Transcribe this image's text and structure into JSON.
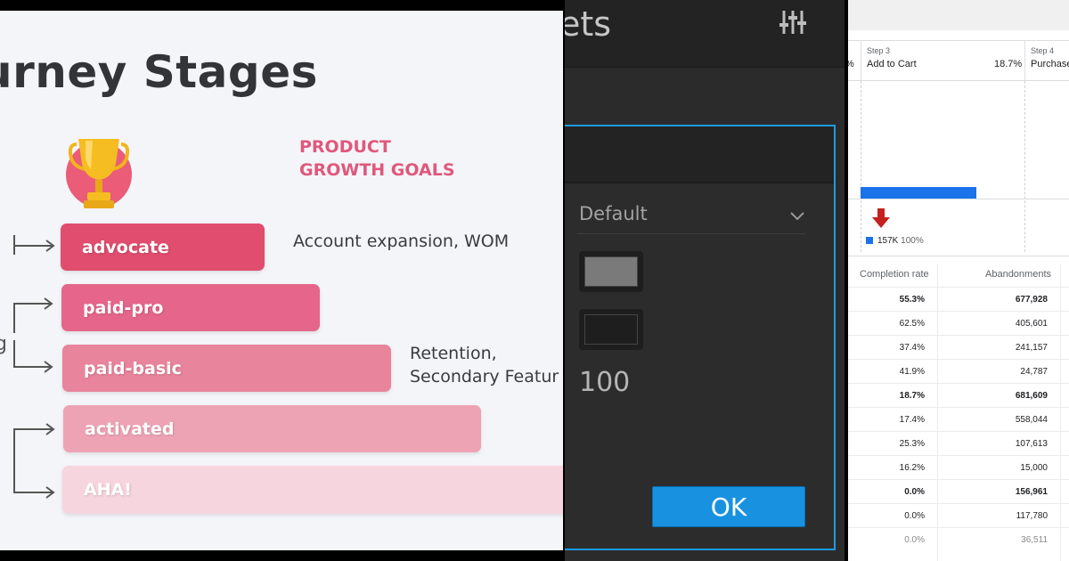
{
  "left": {
    "title": "urney Stages",
    "goals_heading": [
      "PRODUCT",
      "GROWTH GOALS"
    ],
    "side_letter": "g",
    "stages": [
      {
        "label": "advocate",
        "color": "#e04d6e"
      },
      {
        "label": "paid-pro",
        "color": "#e5668a"
      },
      {
        "label": "paid-basic",
        "color": "#e8849c"
      },
      {
        "label": "activated",
        "color": "#eea3b5"
      },
      {
        "label": "AHA!",
        "color": "#f6d5df"
      }
    ],
    "goal_texts": {
      "advocate": "Account expansion, WOM",
      "retention": [
        "Retention,",
        "Secondary Featur"
      ]
    }
  },
  "middle": {
    "title": "ets",
    "select_value": "Default",
    "swatch_colors": [
      "#7a7a7a",
      "#1e1e1e"
    ],
    "number_value": "100",
    "ok_label": "OK",
    "accent": "#1d9be0"
  },
  "right": {
    "partial_pct": "%",
    "steps": [
      {
        "num": "Step 3",
        "name": "Add to Cart",
        "pct": "18.7%"
      },
      {
        "num": "Step 4",
        "name": "Purchase"
      }
    ],
    "legend_value": "157K",
    "legend_sub": "100%",
    "bar_color": "#1a73e8",
    "columns": [
      "Completion rate",
      "Abandonments"
    ],
    "rows": [
      {
        "completion": "55.3%",
        "abandonments": "677,928",
        "style": "bold"
      },
      {
        "completion": "62.5%",
        "abandonments": "405,601",
        "style": "normal"
      },
      {
        "completion": "37.4%",
        "abandonments": "241,157",
        "style": "normal"
      },
      {
        "completion": "41.9%",
        "abandonments": "24,787",
        "style": "normal"
      },
      {
        "completion": "18.7%",
        "abandonments": "681,609",
        "style": "bold"
      },
      {
        "completion": "17.4%",
        "abandonments": "558,044",
        "style": "normal"
      },
      {
        "completion": "25.3%",
        "abandonments": "107,613",
        "style": "normal"
      },
      {
        "completion": "16.2%",
        "abandonments": "15,000",
        "style": "normal"
      },
      {
        "completion": "0.0%",
        "abandonments": "156,961",
        "style": "bold"
      },
      {
        "completion": "0.0%",
        "abandonments": "117,780",
        "style": "normal"
      },
      {
        "completion": "0.0%",
        "abandonments": "36,511",
        "style": "faded"
      }
    ]
  }
}
